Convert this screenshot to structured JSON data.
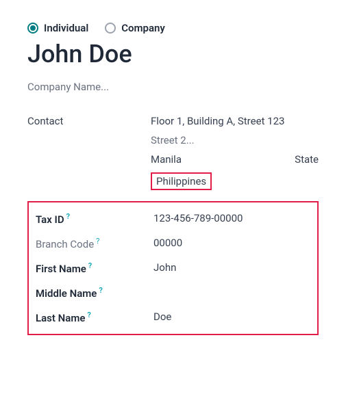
{
  "type_selector": {
    "individual_label": "Individual",
    "company_label": "Company",
    "selected": "individual"
  },
  "heading_name": "John Doe",
  "company_name_placeholder": "Company Name...",
  "contact_section": {
    "label": "Contact",
    "street1": "Floor 1, Building A, Street 123",
    "street2_placeholder": "Street 2...",
    "city": "Manila",
    "state_placeholder": "State",
    "country": "Philippines"
  },
  "help_glyph": "?",
  "fields": {
    "tax_id": {
      "label": "Tax ID",
      "value": "123-456-789-00000"
    },
    "branch_code": {
      "label": "Branch Code",
      "value": "00000"
    },
    "first_name": {
      "label": "First Name",
      "value": "John"
    },
    "middle_name": {
      "label": "Middle Name",
      "value": ""
    },
    "last_name": {
      "label": "Last Name",
      "value": "Doe"
    }
  }
}
